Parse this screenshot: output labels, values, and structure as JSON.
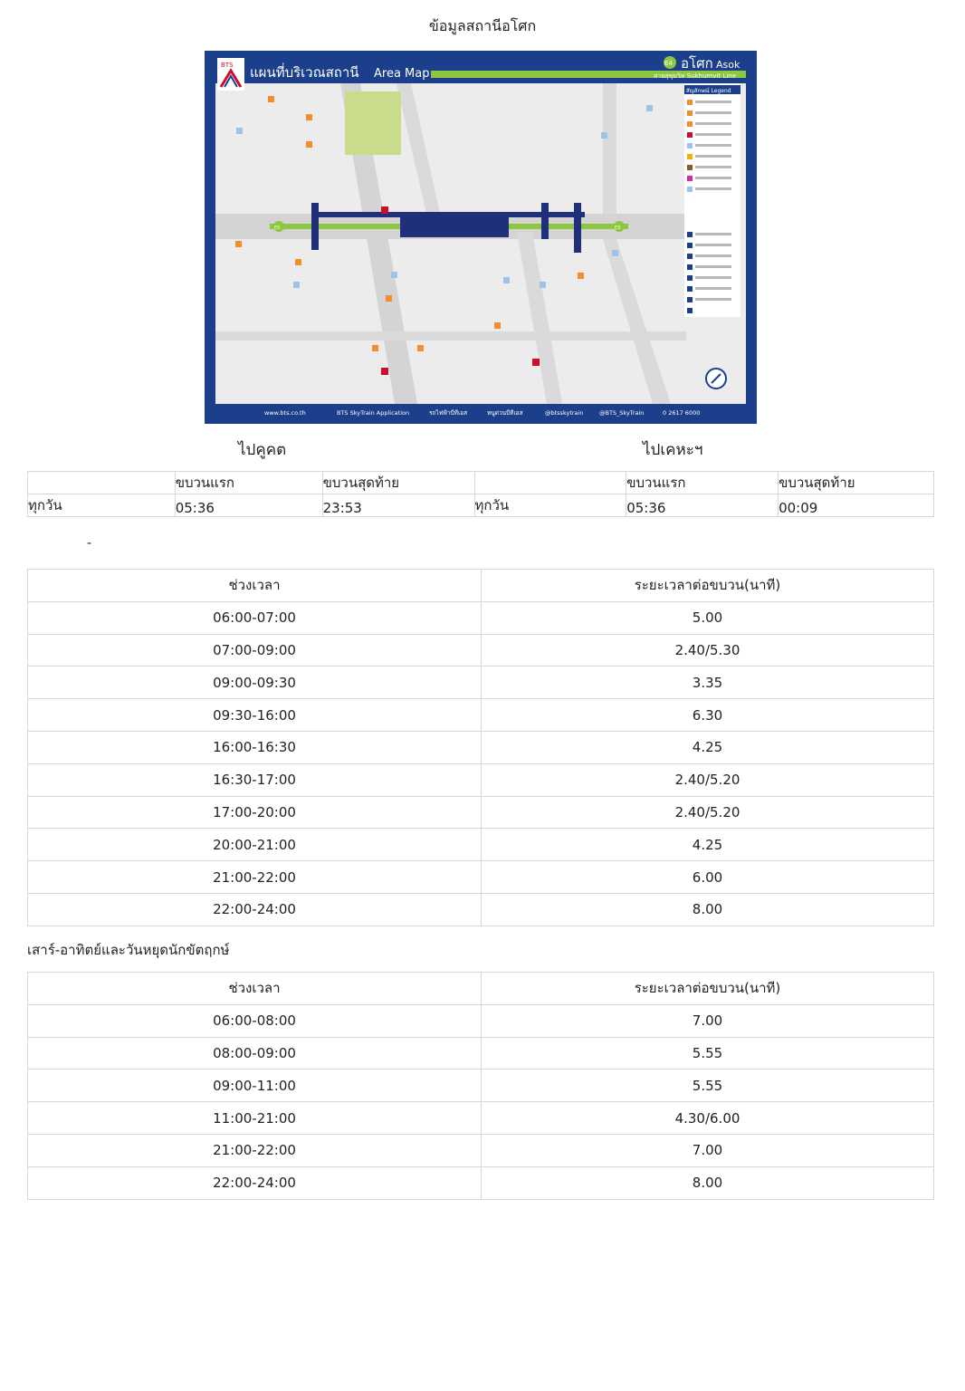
{
  "page_title": "ข้อมูลสถานีอโศก",
  "map": {
    "title_th": "แผนที่บริเวณสถานี",
    "title_en": "Area Map",
    "logo_text": "BTS",
    "station_code": "E4",
    "station_th": "อโศก",
    "station_en": "Asok",
    "line_name": "สายสุขุมวิท Sukhumvit Line",
    "legend_title": "สัญลักษณ์ Legend",
    "code_left": "E3",
    "code_right": "E5",
    "footer": [
      "www.bts.co.th",
      "BTS SkyTrain Application",
      "รถไฟฟ้าบีทีเอส",
      "หนูด่วนบีทีเอส",
      "@btsskytrain",
      "@BTS_SkyTrain",
      "0 2617 6000"
    ],
    "colors": {
      "frame": "#1b3f8b",
      "green": "#8dc63f",
      "platform": "#1f2f7a",
      "ground": "#e9e9e9"
    }
  },
  "directions": {
    "left": "ไปคูคต",
    "right": "ไปเคหะฯ"
  },
  "first_last": {
    "left": {
      "first_label": "ขบวนแรก",
      "last_label": "ขบวนสุดท้าย",
      "day": "ทุกวัน",
      "first": "05:36",
      "last": "23:53"
    },
    "right": {
      "first_label": "ขบวนแรก",
      "last_label": "ขบวนสุดท้าย",
      "day": "ทุกวัน",
      "first": "05:36",
      "last": "00:09"
    }
  },
  "weekday_note": "-",
  "weekday": {
    "headers": [
      "ช่วงเวลา",
      "ระยะเวลาต่อขบวน(นาที)"
    ],
    "rows": [
      [
        "06:00-07:00",
        "5.00"
      ],
      [
        "07:00-09:00",
        "2.40/5.30"
      ],
      [
        "09:00-09:30",
        "3.35"
      ],
      [
        "09:30-16:00",
        "6.30"
      ],
      [
        "16:00-16:30",
        "4.25"
      ],
      [
        "16:30-17:00",
        "2.40/5.20"
      ],
      [
        "17:00-20:00",
        "2.40/5.20"
      ],
      [
        "20:00-21:00",
        "4.25"
      ],
      [
        "21:00-22:00",
        "6.00"
      ],
      [
        "22:00-24:00",
        "8.00"
      ]
    ]
  },
  "weekend_title": "เสาร์-อาทิตย์และวันหยุดนักขัตฤกษ์",
  "weekend": {
    "headers": [
      "ช่วงเวลา",
      "ระยะเวลาต่อขบวน(นาที)"
    ],
    "rows": [
      [
        "06:00-08:00",
        "7.00"
      ],
      [
        "08:00-09:00",
        "5.55"
      ],
      [
        "09:00-11:00",
        "5.55"
      ],
      [
        "11:00-21:00",
        "4.30/6.00"
      ],
      [
        "21:00-22:00",
        "7.00"
      ],
      [
        "22:00-24:00",
        "8.00"
      ]
    ]
  }
}
